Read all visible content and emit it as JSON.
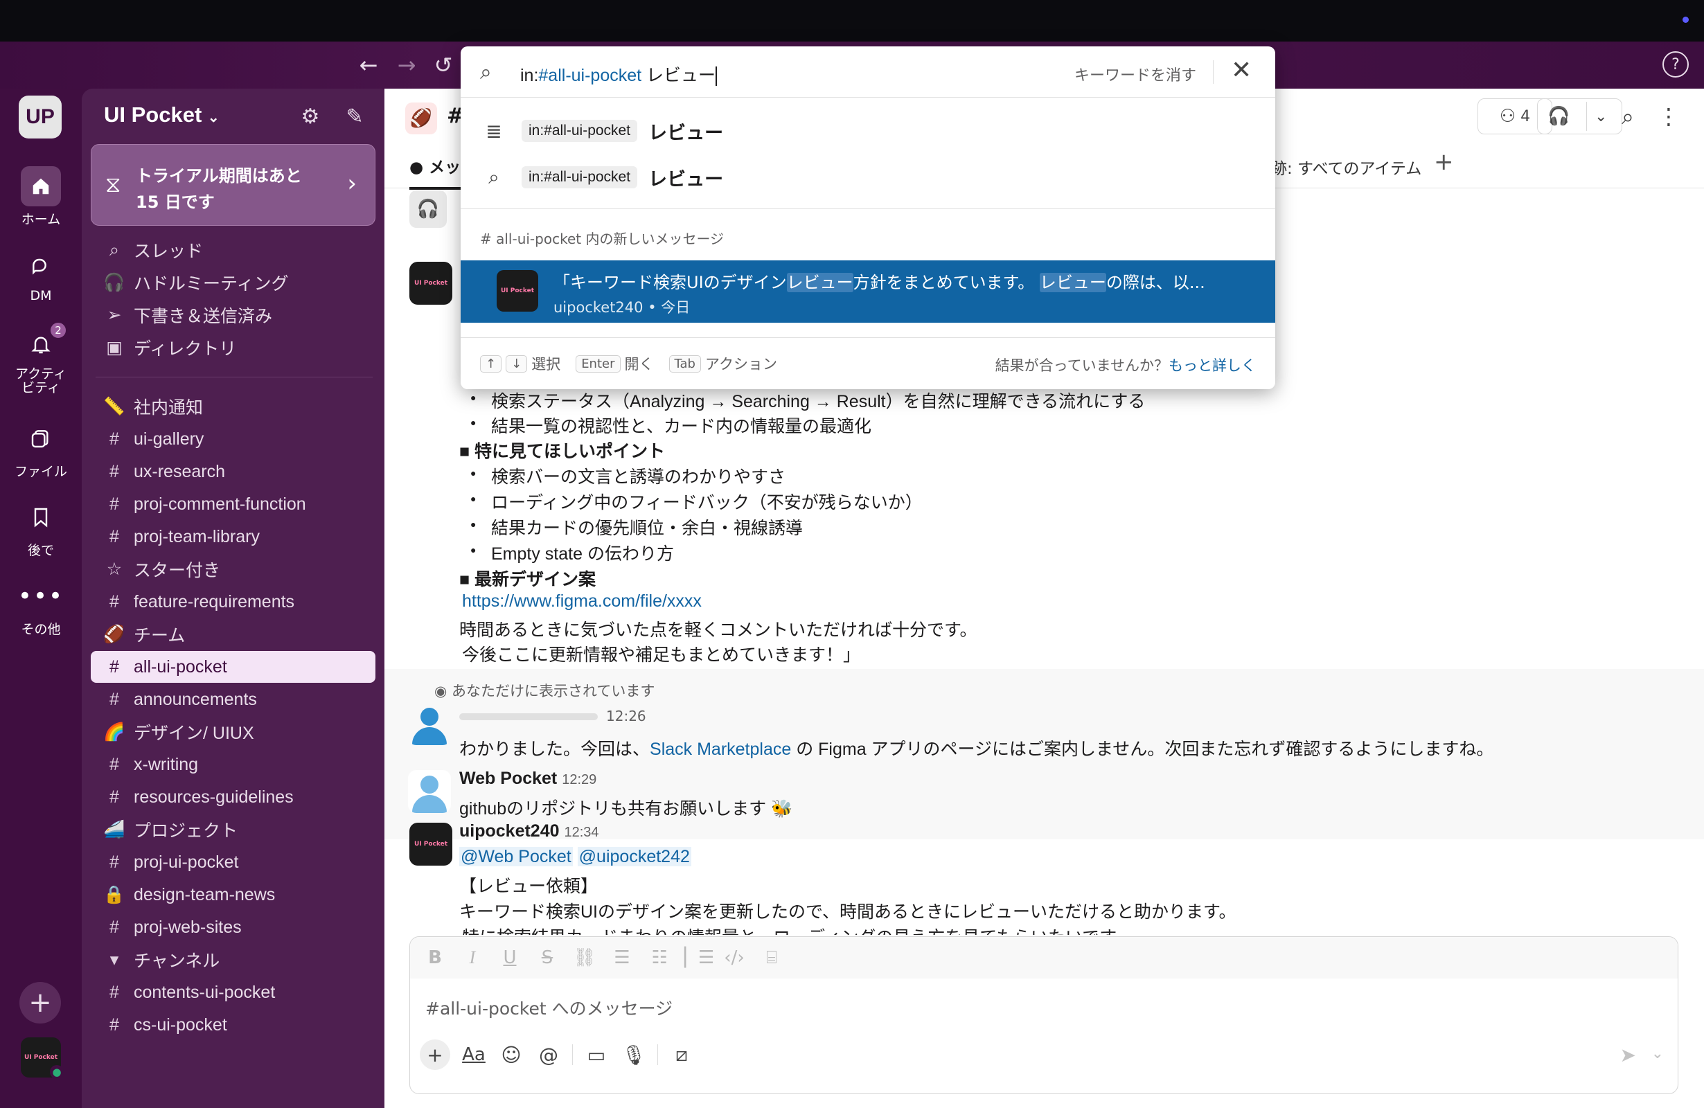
{
  "nav": {
    "back_glyph": "←",
    "forward_glyph": "→",
    "history_glyph": "↺",
    "help_glyph": "?"
  },
  "workspace": {
    "initials": "UP",
    "name": "UI Pocket"
  },
  "rail": {
    "home": "ホーム",
    "dm": "DM",
    "activity_line1": "アクティ",
    "activity_line2": "ビティ",
    "activity_badge": "2",
    "files": "ファイル",
    "later": "後で",
    "more": "その他",
    "add": "+",
    "me_logo": "UI Pocket"
  },
  "trial": {
    "line1": "トライアル期間はあと",
    "line2": "15 日です"
  },
  "sidebar": {
    "nav_items": [
      {
        "icon": "⌕",
        "label": "スレッド"
      },
      {
        "icon": "🎧",
        "label": "ハドルミーティング"
      },
      {
        "icon": "➢",
        "label": "下書き＆送信済み"
      },
      {
        "icon": "▣",
        "label": "ディレクトリ"
      }
    ],
    "rows": [
      {
        "icon": "📏",
        "label": "社内通知"
      },
      {
        "icon": "#",
        "label": "ui-gallery"
      },
      {
        "icon": "#",
        "label": "ux-research"
      },
      {
        "icon": "#",
        "label": "proj-comment-function"
      },
      {
        "icon": "#",
        "label": "proj-team-library"
      },
      {
        "icon": "☆",
        "label": "スター付き"
      },
      {
        "icon": "#",
        "label": "feature-requirements"
      },
      {
        "icon": "🏈",
        "label": "チーム"
      },
      {
        "icon": "#",
        "label": "all-ui-pocket"
      },
      {
        "icon": "#",
        "label": "announcements"
      },
      {
        "icon": "🌈",
        "label": "デザイン/ UIUX"
      },
      {
        "icon": "#",
        "label": "x-writing"
      },
      {
        "icon": "#",
        "label": "resources-guidelines"
      },
      {
        "icon": "🚄",
        "label": "プロジェクト"
      },
      {
        "icon": "#",
        "label": "proj-ui-pocket"
      },
      {
        "icon": "🔒",
        "label": "design-team-news"
      },
      {
        "icon": "#",
        "label": "proj-web-sites"
      },
      {
        "icon": "▾",
        "label": "チャンネル"
      },
      {
        "icon": "#",
        "label": "contents-ui-pocket"
      },
      {
        "icon": "#",
        "label": "cs-ui-pocket"
      }
    ]
  },
  "header": {
    "channel_emoji": "🏈",
    "channel_hash": "#",
    "member_count": "4",
    "tab_messages": "メッ",
    "tab_right": "跡: すべてのアイテム",
    "tab_add": "+"
  },
  "messages": {
    "bullets1": [
      "検索ステータス（Analyzing → Searching → Result）を自然に理解できる流れにする",
      "結果一覧の視認性と、カード内の情報量の最適化"
    ],
    "heading2": "■ 特に見てほしいポイント",
    "bullets2": [
      "検索バーの文言と誘導のわかりやすさ",
      "ローディング中のフィードバック（不安が残らないか）",
      "結果カードの優先順位・余白・視線誘導",
      "Empty state の伝わり方"
    ],
    "heading3": "■ 最新デザイン案",
    "figma_link": "https://www.figma.com/file/xxxx",
    "closing1": "時間あるときに気づいた点を軽くコメントいただければ十分です。",
    "closing2": "今後ここに更新情報や補足もまとめていきます！」",
    "ephemeral_note": "あなただけに表示されています",
    "bot_time": "12:26",
    "bot_pre": "わかりました。今回は、",
    "bot_link": "Slack Marketplace",
    "bot_post": " の Figma アプリのページにはご案内しません。次回また忘れず確認するようにしますね。",
    "wp_name": "Web Pocket",
    "wp_time": "12:29",
    "wp_text": "githubのリポジトリも共有お願いします",
    "up_name": "uipocket240",
    "up_time": "12:34",
    "mention1": "@Web Pocket",
    "mention2": "@uipocket242",
    "req_title": "【レビュー依頼】",
    "req_line1": "キーワード検索UIのデザイン案を更新したので、時間あるときにレビューいただけると助かります。",
    "req_line2": "特に検索結果カードまわりの情報量と、ローディングの見え方を見てもらいたいです。"
  },
  "composer": {
    "placeholder": "#all-ui-pocket へのメッセージ"
  },
  "search": {
    "query_prefix": "in:",
    "query_channel": "#all-ui-pocket",
    "query_keyword": "レビュー",
    "clear_label": "キーワードを消す",
    "suggestions": [
      {
        "chip": "in:#all-ui-pocket",
        "keyword": "レビュー"
      },
      {
        "chip": "in:#all-ui-pocket",
        "keyword": "レビュー"
      }
    ],
    "section_label": "# all-ui-pocket 内の新しいメッセージ",
    "result": {
      "pre": "「キーワード検索UIのデザイン",
      "hl1": "レビュー",
      "mid": "方針をまとめています。 ",
      "hl2": "レビュー",
      "post": "の際は、以...",
      "author": "uipocket240",
      "dot": "•",
      "date": "今日",
      "avatar": "UI Pocket"
    },
    "footer": {
      "up": "↑",
      "down": "↓",
      "select": "選択",
      "enter_key": "Enter",
      "open": "開く",
      "tab_key": "Tab",
      "action": "アクション",
      "mismatch": "結果が合っていませんか？",
      "more_link": "もっと詳しく"
    }
  }
}
